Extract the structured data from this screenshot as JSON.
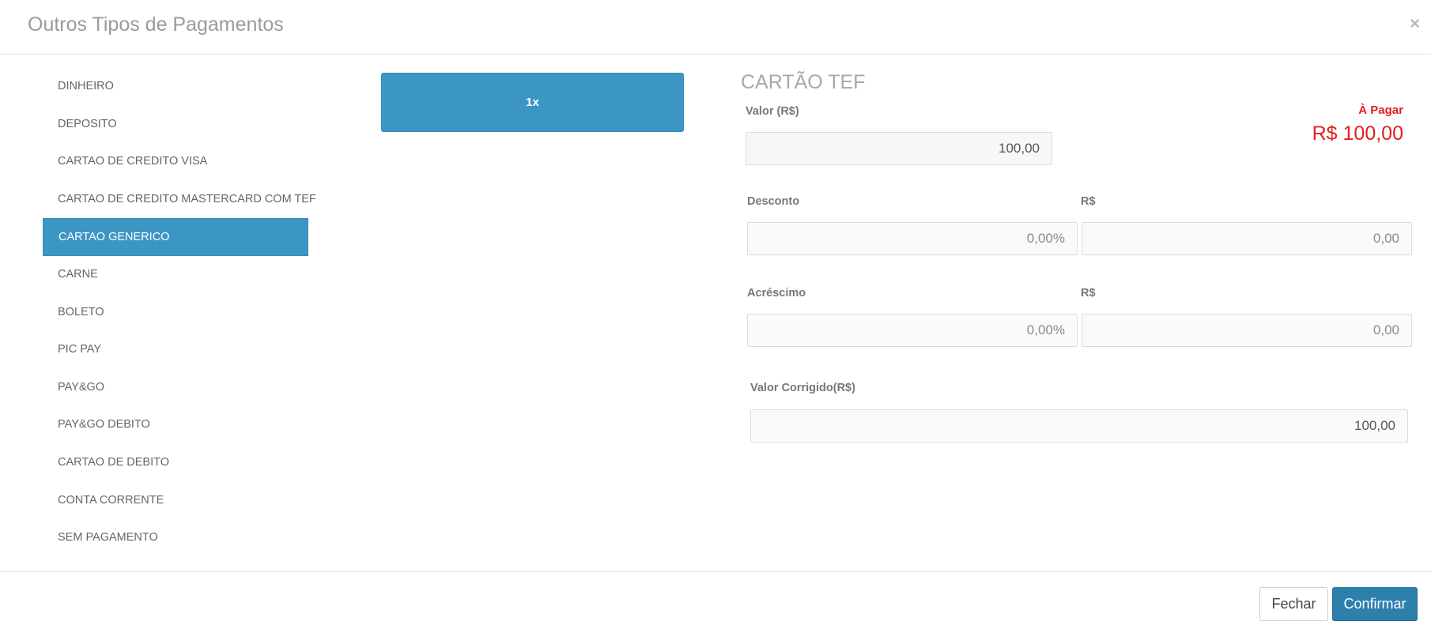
{
  "header": {
    "title": "Outros Tipos de Pagamentos",
    "close_label": "×"
  },
  "methods": [
    "DINHEIRO",
    "DEPOSITO",
    "CARTAO DE CREDITO VISA",
    "CARTAO DE CREDITO MASTERCARD COM TEF",
    "CARTAO GENERICO",
    "CARNE",
    "BOLETO",
    "PIC PAY",
    "PAY&GO",
    "PAY&GO DEBITO",
    "CARTAO DE DEBITO",
    "CONTA CORRENTE",
    "SEM PAGAMENTO"
  ],
  "installment": {
    "label": "1x"
  },
  "form": {
    "section_title": "CARTÃO TEF",
    "valor_label": "Valor (R$)",
    "valor_value": "100,00",
    "desconto_label": "Desconto",
    "desconto_currency_label": "R$",
    "desconto_percent": "0,00%",
    "desconto_value": "0,00",
    "acrescimo_label": "Acréscimo",
    "acrescimo_currency_label": "R$",
    "acrescimo_percent": "0,00%",
    "acrescimo_value": "0,00",
    "corrigido_label": "Valor Corrigido(R$)",
    "corrigido_value": "100,00"
  },
  "to_pay": {
    "label": "À Pagar",
    "amount": "R$ 100,00"
  },
  "footer": {
    "close_label": "Fechar",
    "confirm_label": "Confirmar"
  },
  "colors": {
    "accent": "#3c96c4",
    "danger": "#e02020",
    "confirm": "#2d80ac"
  }
}
